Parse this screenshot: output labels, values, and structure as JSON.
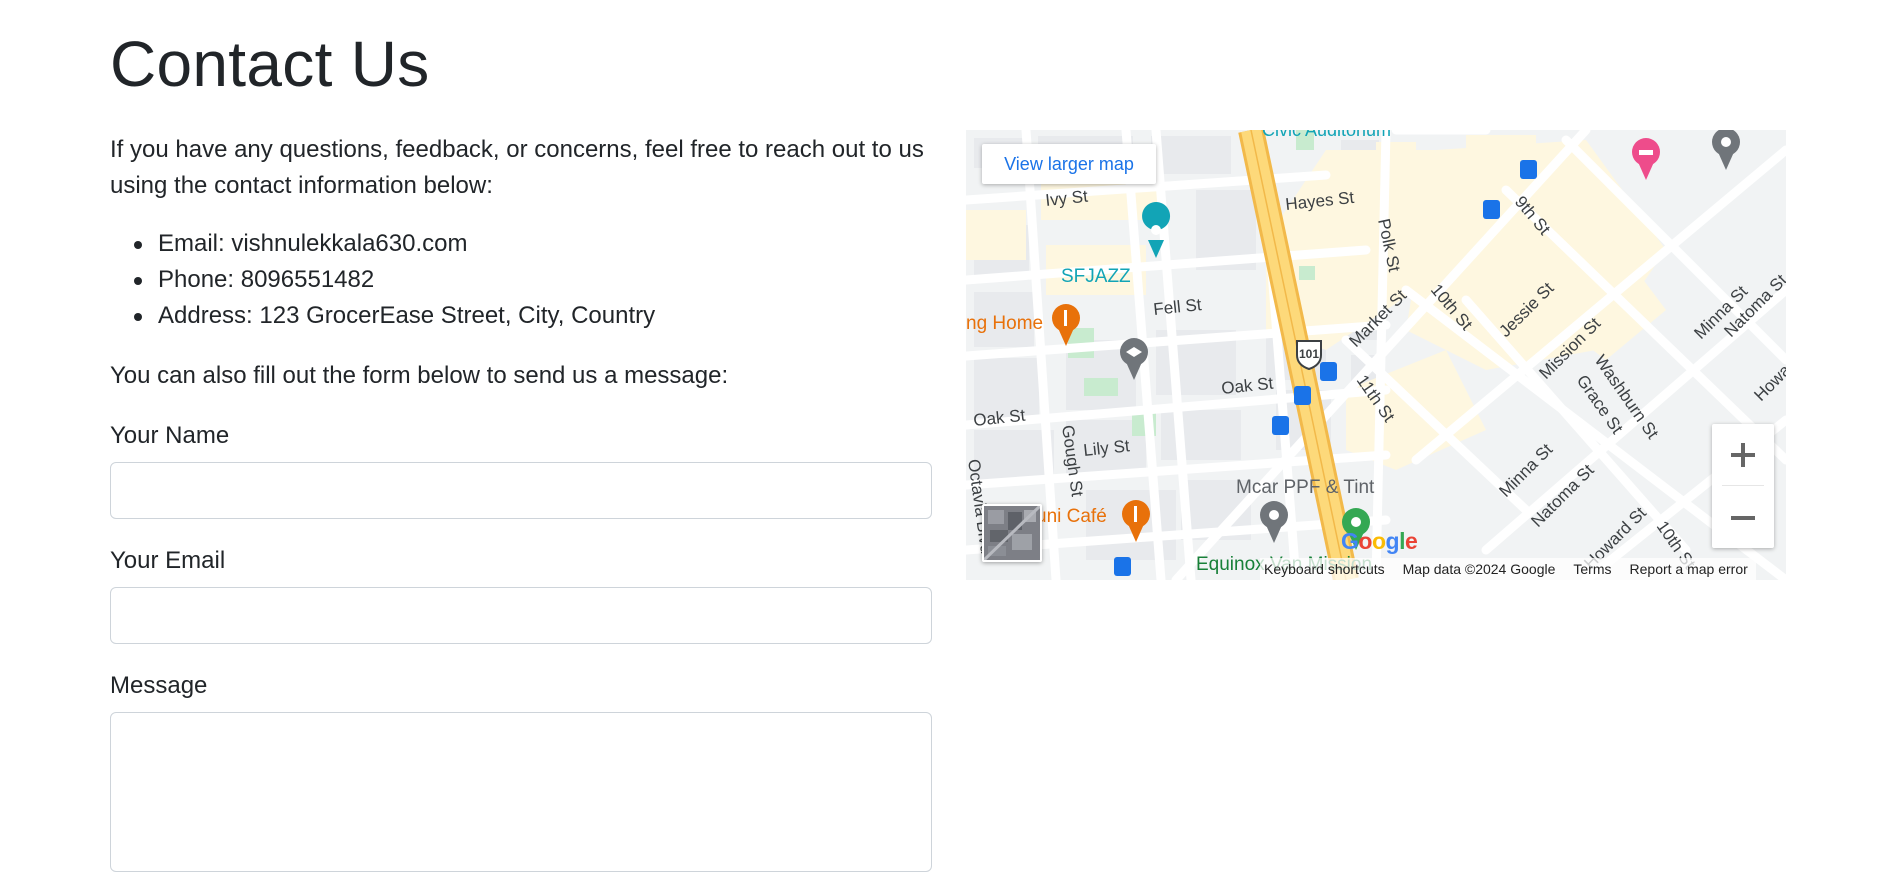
{
  "page": {
    "title": "Contact Us",
    "intro": "If you have any questions, feedback, or concerns, feel free to reach out to us using the contact information below:",
    "contact_items": [
      "Email: vishnulekkala630.com",
      "Phone: 8096551482",
      "Address: 123 GrocerEase Street, City, Country"
    ],
    "form_intro": "You can also fill out the form below to send us a message:"
  },
  "form": {
    "name_label": "Your Name",
    "name_value": "",
    "email_label": "Your Email",
    "email_value": "",
    "message_label": "Message",
    "message_value": ""
  },
  "map": {
    "view_larger_label": "View larger map",
    "zoom_in_icon": "plus-icon",
    "zoom_out_icon": "minus-icon",
    "logo_text": "Google",
    "attribution": {
      "keyboard_shortcuts": "Keyboard shortcuts",
      "map_data": "Map data ©2024 Google",
      "terms": "Terms",
      "report": "Report a map error"
    },
    "street_labels": [
      "Ivy St",
      "Hayes St",
      "Polk St",
      "9th St",
      "Fell St",
      "Market St",
      "10th St",
      "Jessie St",
      "Oak St",
      "11th St",
      "Mission St",
      "Washburn St",
      "Grace St",
      "Minna St",
      "Natoma St",
      "Howard St",
      "Lily St",
      "Gough St",
      "Octavia Blvd",
      "Civic Auditorium"
    ],
    "poi_labels": [
      "SFJAZZ",
      "ng Home",
      "Mcar PPF & Tint",
      "uni Café",
      "Equinox Van Mission"
    ],
    "highway_shield": "101",
    "colors": {
      "road_major": "#fdd97a",
      "road_major_edge": "#f2b94a",
      "land": "#f1f3f4",
      "block": "#e8eaed",
      "commercial": "#fef7e0",
      "park": "#c8ebcf",
      "transit": "#1a73e8",
      "poi_teal": "#12a4b6",
      "poi_orange": "#e8710a",
      "poi_grey": "#70757a",
      "poi_pink": "#ee4c8b",
      "poi_green": "#34a853"
    }
  }
}
